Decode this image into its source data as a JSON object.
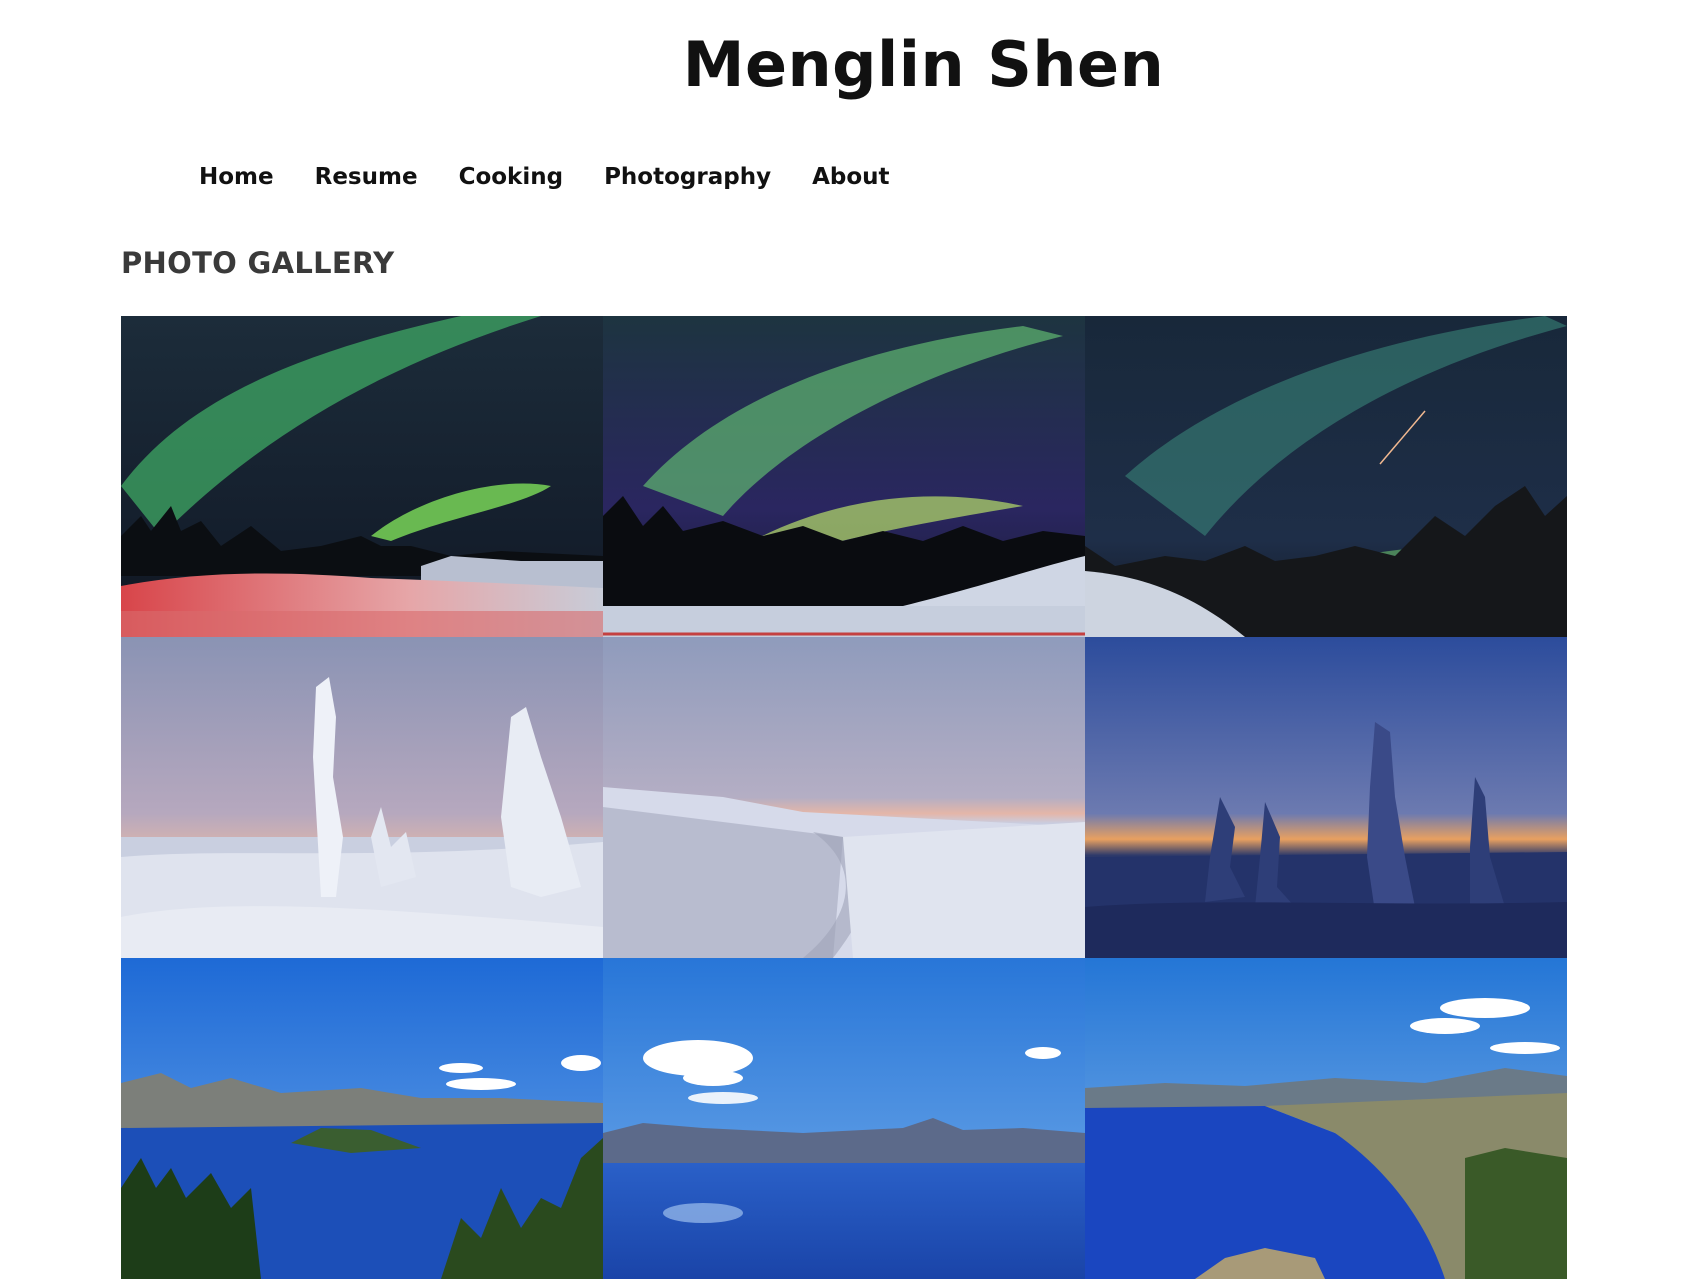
{
  "site": {
    "title": "Menglin Shen"
  },
  "nav": {
    "items": [
      {
        "label": "Home"
      },
      {
        "label": "Resume"
      },
      {
        "label": "Cooking"
      },
      {
        "label": "Photography"
      },
      {
        "label": "About"
      }
    ]
  },
  "gallery": {
    "heading": "PHOTO GALLERY",
    "photos": [
      {
        "subject": "aurora over snowy hill with red-lit snowbank"
      },
      {
        "subject": "aurora over tree line and snow slope"
      },
      {
        "subject": "faint aurora with shooting star over trees"
      },
      {
        "subject": "snow-covered trees at dusk"
      },
      {
        "subject": "snowy road at dusk"
      },
      {
        "subject": "snow-covered spruce silhouettes at twilight"
      },
      {
        "subject": "Crater Lake with Wizard Island"
      },
      {
        "subject": "Crater Lake with clouds reflected"
      },
      {
        "subject": "Crater Lake from rim overlook"
      }
    ]
  },
  "colors": {
    "text": "#111111",
    "heading": "#3a3a3a",
    "background": "#ffffff"
  }
}
